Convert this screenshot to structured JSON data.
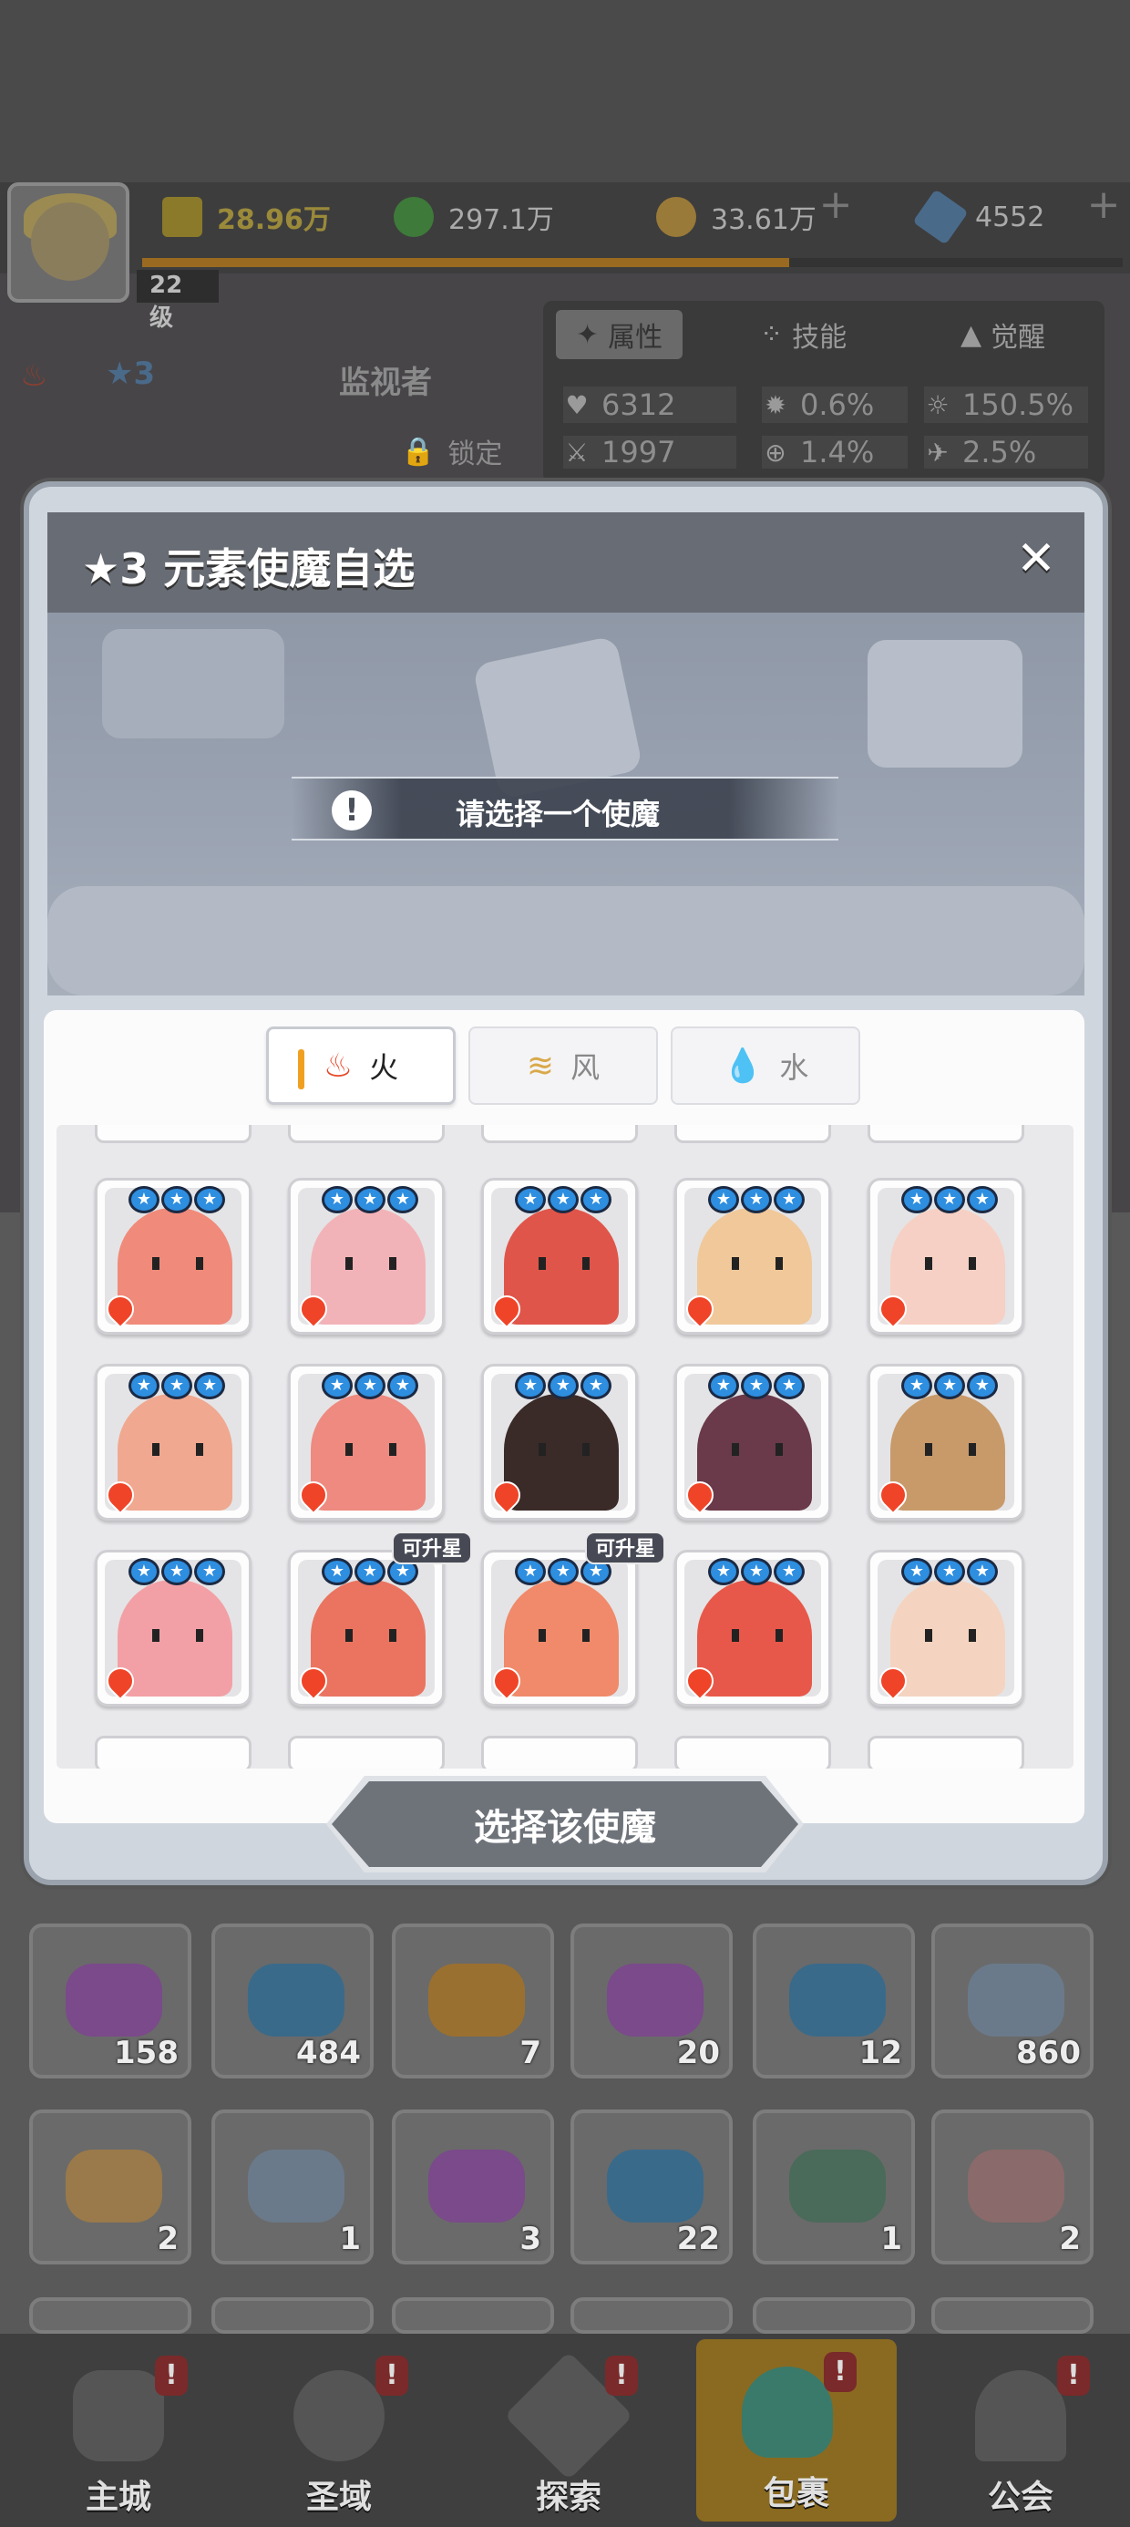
{
  "player": {
    "level": "22级"
  },
  "resources": [
    {
      "name": "power",
      "value": "28.96万",
      "color": "#8a7a2a"
    },
    {
      "name": "green-gem",
      "value": "297.1万",
      "color": "#3e7a3a"
    },
    {
      "name": "gold",
      "value": "33.61万",
      "color": "#9a7a38"
    },
    {
      "name": "crystal",
      "value": "4552",
      "color": "#4a6a8a"
    }
  ],
  "exp_fraction": 0.66,
  "hero": {
    "stars": "3",
    "name": "监视者",
    "lock_label": "锁定"
  },
  "hero_tabs": [
    {
      "label": "属性",
      "icon": "attribute-icon",
      "active": true
    },
    {
      "label": "技能",
      "icon": "skill-icon",
      "active": false
    },
    {
      "label": "觉醒",
      "icon": "awaken-icon",
      "active": false
    }
  ],
  "stats": [
    {
      "icon": "heart-icon",
      "glyph": "♥",
      "value": "6312"
    },
    {
      "icon": "burst-icon",
      "glyph": "✹",
      "value": "0.6%"
    },
    {
      "icon": "sun-icon",
      "glyph": "☼",
      "value": "150.5%"
    },
    {
      "icon": "sword-icon",
      "glyph": "⚔",
      "value": "1997"
    },
    {
      "icon": "target-icon",
      "glyph": "⊕",
      "value": "1.4%"
    },
    {
      "icon": "wing-icon",
      "glyph": "✈",
      "value": "2.5%"
    }
  ],
  "modal": {
    "title": "★3 元素使魔自选",
    "close": "✕",
    "prompt": "请选择一个使魔",
    "select_button": "选择该使魔",
    "element_tabs": [
      {
        "label": "火",
        "icon": "fire-icon",
        "active": true,
        "color": "#e8482a"
      },
      {
        "label": "风",
        "icon": "wind-icon",
        "active": false,
        "color": "#d9a84a"
      },
      {
        "label": "水",
        "icon": "water-icon",
        "active": false,
        "color": "#5a9be0"
      }
    ],
    "familiars": [
      {
        "color": "#f08a7a",
        "upgradable": false
      },
      {
        "color": "#f2b3b8",
        "upgradable": false
      },
      {
        "color": "#e0554a",
        "upgradable": false
      },
      {
        "color": "#f0c89a",
        "upgradable": false
      },
      {
        "color": "#f6d0c4",
        "upgradable": false
      },
      {
        "color": "#f0a890",
        "upgradable": false
      },
      {
        "color": "#ee8a80",
        "upgradable": false
      },
      {
        "color": "#3a2a28",
        "upgradable": false
      },
      {
        "color": "#6a3a4a",
        "upgradable": false
      },
      {
        "color": "#c89a6a",
        "upgradable": false
      },
      {
        "color": "#f2a0a6",
        "upgradable": false
      },
      {
        "color": "#ea7460",
        "upgradable": true
      },
      {
        "color": "#f08a6a",
        "upgradable": true
      },
      {
        "color": "#e8584a",
        "upgradable": false
      },
      {
        "color": "#f4d4c0",
        "upgradable": false
      }
    ],
    "upgrade_label": "可升星"
  },
  "bag_items": [
    {
      "count": "158",
      "color": "#7a4a8a"
    },
    {
      "count": "484",
      "color": "#3a6a8a"
    },
    {
      "count": "7",
      "color": "#9a7030"
    },
    {
      "count": "20",
      "color": "#7a4a8a"
    },
    {
      "count": "12",
      "color": "#3a6a8a"
    },
    {
      "count": "860",
      "color": "#6a7a8a"
    },
    {
      "count": "2",
      "color": "#9a7a4a"
    },
    {
      "count": "1",
      "color": "#6a7a8a"
    },
    {
      "count": "3",
      "color": "#7a4a8a"
    },
    {
      "count": "22",
      "color": "#3a6a8a"
    },
    {
      "count": "1",
      "color": "#4a6a5a"
    },
    {
      "count": "2",
      "color": "#8a6a6a"
    }
  ],
  "nav": [
    {
      "label": "主城",
      "icon": "castle-icon",
      "badge": "!"
    },
    {
      "label": "圣域",
      "icon": "portal-icon",
      "badge": "!"
    },
    {
      "label": "探索",
      "icon": "explore-icon",
      "badge": "!"
    },
    {
      "label": "包裹",
      "icon": "bag-icon",
      "badge": "!",
      "active": true
    },
    {
      "label": "公会",
      "icon": "guild-icon",
      "badge": "!"
    }
  ]
}
